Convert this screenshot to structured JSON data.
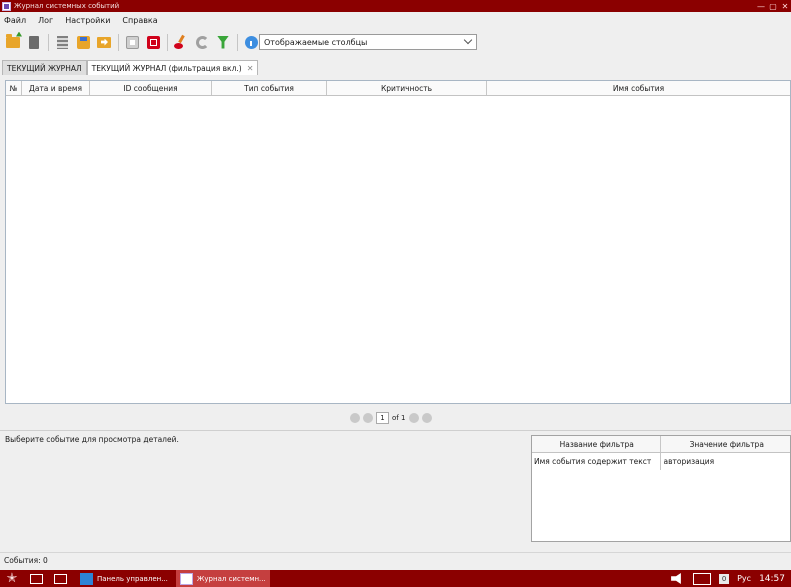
{
  "window": {
    "title": "Журнал системных событий",
    "controls": [
      "—",
      "▢",
      "✕"
    ]
  },
  "menu": [
    "Файл",
    "Лог",
    "Настройки",
    "Справка"
  ],
  "toolbar": {
    "icons": [
      "open-folder-icon",
      "document-icon",
      "list-icon",
      "save-icon",
      "export-icon",
      "play-icon",
      "stop-icon",
      "clear-icon",
      "refresh-icon",
      "filter-icon",
      "info-icon"
    ],
    "columns_combo": "Отображаемые столбцы"
  },
  "tabs": [
    {
      "label": "ТЕКУЩИЙ ЖУРНАЛ",
      "active": false
    },
    {
      "label": "ТЕКУЩИЙ ЖУРНАЛ (фильтрация вкл.)",
      "active": true,
      "close": "✕"
    }
  ],
  "grid": {
    "columns": [
      "№",
      "Дата и время",
      "ID сообщения",
      "Тип события",
      "Критичность",
      "Имя события"
    ]
  },
  "pager": {
    "page": "1",
    "of_total": "of 1"
  },
  "details": {
    "placeholder": "Выберите событие для просмотра деталей."
  },
  "filters": {
    "headers": [
      "Название фильтра",
      "Значение фильтра"
    ],
    "rows": [
      [
        "Имя события содержит текст",
        "авторизация"
      ]
    ]
  },
  "status": {
    "events": "События: 0"
  },
  "taskbar": {
    "tasks": [
      {
        "label": "Панель управлен...",
        "active": false
      },
      {
        "label": "Журнал системн...",
        "active": true
      }
    ],
    "badge": "0",
    "lang": "Рус",
    "clock": "14:57"
  },
  "colors": {
    "titlebar": "#8b0000",
    "taskbar": "#8b0000",
    "active_task": "#c53f3f"
  }
}
